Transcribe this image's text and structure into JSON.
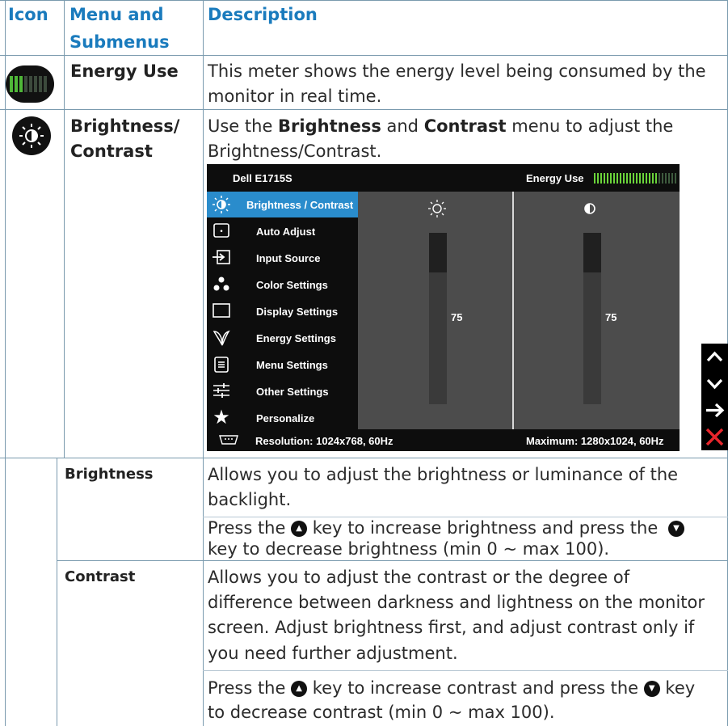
{
  "header": {
    "icon": "Icon",
    "menu": "Menu and",
    "menu2": "Submenus",
    "description": "Description"
  },
  "rows": {
    "energy": {
      "name": "Energy Use",
      "desc1": "This meter shows the energy level being consumed by the",
      "desc2": "monitor in real time."
    },
    "brightness_contrast": {
      "name1": "Brightness/",
      "name2": "Contrast",
      "desc_pre": "Use the ",
      "desc_b1": "Brightness",
      "desc_mid": " and ",
      "desc_b2": "Contrast",
      "desc_post": " menu to adjust the",
      "desc2": "Brightness/Contrast."
    },
    "brightness": {
      "name": "Brightness",
      "desc1": "Allows you to adjust the brightness or luminance of the",
      "desc2": "backlight.",
      "press_pre": "Press the ",
      "press_mid": " key to increase brightness and press the ",
      "press2": "key to decrease brightness (min 0 ~ max 100)."
    },
    "contrast": {
      "name": "Contrast",
      "desc1": "Allows you to adjust the contrast or the degree of",
      "desc2": "difference between darkness and lightness on the monitor",
      "desc3": "screen. Adjust brightness first, and adjust contrast only if",
      "desc4": "you need further adjustment.",
      "press_pre": "Press the ",
      "press_mid": "  key to increase contrast and press the ",
      "press_post": " key",
      "press2": "to decrease contrast (min 0 ~ max 100)."
    }
  },
  "osd": {
    "model": "Dell E1715S",
    "energy_label": "Energy Use",
    "menu_items": [
      {
        "icon": "brightness-icon",
        "label": "Brightness / Contrast"
      },
      {
        "icon": "auto-adjust-icon",
        "label": "Auto Adjust"
      },
      {
        "icon": "input-source-icon",
        "label": "Input Source"
      },
      {
        "icon": "color-settings-icon",
        "label": "Color Settings"
      },
      {
        "icon": "display-settings-icon",
        "label": "Display Settings"
      },
      {
        "icon": "energy-settings-icon",
        "label": "Energy Settings"
      },
      {
        "icon": "menu-settings-icon",
        "label": "Menu Settings"
      },
      {
        "icon": "other-settings-icon",
        "label": "Other Settings"
      },
      {
        "icon": "personalize-icon",
        "label": "Personalize"
      }
    ],
    "brightness_value": "75",
    "contrast_value": "75",
    "brightness_level": 75,
    "contrast_level": 75,
    "resolution": "Resolution: 1024x768, 60Hz",
    "maximum": "Maximum: 1280x1024, 60Hz"
  },
  "colors": {
    "accent": "#1a7bbd",
    "selected": "#2a8ccc",
    "close": "#e8262c"
  },
  "nav_keys": [
    "up-icon",
    "down-icon",
    "enter-icon",
    "close-icon"
  ]
}
